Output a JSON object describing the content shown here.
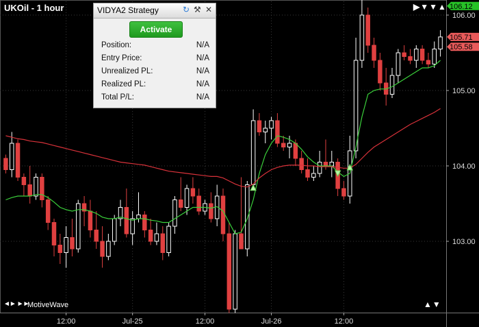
{
  "header": {
    "title": "UKOil - 1 hour"
  },
  "branding": {
    "name": "MotiveWave"
  },
  "strategy_panel": {
    "title": "VIDYA2 Strategy",
    "activate_label": "Activate",
    "rows": [
      {
        "label": "Position:",
        "value": "N/A"
      },
      {
        "label": "Entry Price:",
        "value": "N/A"
      },
      {
        "label": "Unrealized PL:",
        "value": "N/A"
      },
      {
        "label": "Realized PL:",
        "value": "N/A"
      },
      {
        "label": "Total P/L:",
        "value": "N/A"
      }
    ],
    "icons": [
      "refresh-icon",
      "wrench-icon",
      "close-icon"
    ]
  },
  "colors": {
    "bullish": "#000000",
    "bearish": "#e04040",
    "bull_border": "#ffffff",
    "fast_line": "#3bd13b",
    "slow_line": "#d9323a",
    "up_badge": "#27c227",
    "down_badge": "#e85a5a"
  },
  "chart_data": {
    "type": "candlestick",
    "title": "UKOil - 1 hour",
    "ylim": [
      102.05,
      106.2
    ],
    "y_ticks": [
      103.0,
      104.0,
      105.0,
      106.0
    ],
    "y_tick_labels": [
      "103.00",
      "104.00",
      "105.00",
      "106.00"
    ],
    "x_tick_labels": [
      {
        "index": 10,
        "label": "12:00"
      },
      {
        "index": 21,
        "label": "Jul-25"
      },
      {
        "index": 33,
        "label": "12:00"
      },
      {
        "index": 44,
        "label": "Jul-26"
      },
      {
        "index": 56,
        "label": "12:00"
      }
    ],
    "price_badges": [
      {
        "label": "106.12",
        "value": 106.12,
        "kind": "up"
      },
      {
        "label": "105.71",
        "value": 105.71,
        "kind": "down"
      },
      {
        "label": "105.58",
        "value": 105.58,
        "kind": "down"
      }
    ],
    "candles": [
      [
        104.1,
        104.15,
        103.9,
        103.95
      ],
      [
        103.95,
        104.45,
        103.85,
        104.3
      ],
      [
        104.3,
        104.35,
        103.8,
        103.85
      ],
      [
        103.85,
        103.9,
        103.6,
        103.75
      ],
      [
        103.75,
        104.0,
        103.5,
        103.6
      ],
      [
        103.6,
        103.9,
        103.55,
        103.85
      ],
      [
        103.85,
        103.9,
        103.45,
        103.55
      ],
      [
        103.55,
        103.6,
        103.15,
        103.25
      ],
      [
        103.25,
        103.3,
        102.8,
        102.95
      ],
      [
        102.95,
        103.1,
        102.7,
        102.85
      ],
      [
        102.85,
        103.2,
        102.65,
        103.05
      ],
      [
        103.05,
        103.3,
        102.8,
        102.9
      ],
      [
        102.9,
        103.55,
        102.85,
        103.5
      ],
      [
        103.5,
        103.6,
        103.2,
        103.4
      ],
      [
        103.4,
        103.55,
        103.05,
        103.15
      ],
      [
        103.15,
        103.4,
        102.9,
        103.0
      ],
      [
        103.0,
        103.2,
        102.65,
        102.8
      ],
      [
        102.8,
        103.1,
        102.75,
        103.0
      ],
      [
        103.0,
        103.35,
        102.95,
        103.3
      ],
      [
        103.3,
        103.55,
        103.2,
        103.45
      ],
      [
        103.45,
        103.7,
        103.05,
        103.1
      ],
      [
        103.1,
        103.4,
        102.95,
        103.3
      ],
      [
        103.3,
        103.65,
        103.25,
        103.35
      ],
      [
        103.35,
        103.4,
        103.05,
        103.15
      ],
      [
        103.15,
        103.3,
        102.95,
        103.0
      ],
      [
        103.0,
        103.25,
        102.95,
        103.1
      ],
      [
        103.1,
        103.2,
        102.75,
        102.85
      ],
      [
        102.85,
        103.25,
        102.8,
        103.2
      ],
      [
        103.2,
        103.6,
        103.1,
        103.55
      ],
      [
        103.55,
        103.85,
        103.4,
        103.45
      ],
      [
        103.45,
        103.75,
        103.35,
        103.7
      ],
      [
        103.7,
        103.85,
        103.5,
        103.6
      ],
      [
        103.6,
        103.7,
        103.35,
        103.4
      ],
      [
        103.4,
        103.55,
        103.35,
        103.5
      ],
      [
        103.5,
        103.65,
        103.25,
        103.3
      ],
      [
        103.3,
        103.75,
        103.2,
        103.6
      ],
      [
        103.6,
        103.7,
        103.0,
        103.1
      ],
      [
        103.1,
        103.25,
        102.05,
        102.1
      ],
      [
        102.1,
        103.15,
        102.05,
        103.1
      ],
      [
        103.1,
        103.85,
        102.95,
        102.9
      ],
      [
        102.9,
        103.8,
        102.8,
        103.75
      ],
      [
        103.75,
        104.75,
        103.7,
        104.6
      ],
      [
        104.6,
        104.7,
        104.4,
        104.45
      ],
      [
        104.45,
        104.6,
        104.3,
        104.5
      ],
      [
        104.5,
        104.65,
        104.35,
        104.6
      ],
      [
        104.6,
        104.7,
        104.25,
        104.3
      ],
      [
        104.3,
        104.4,
        104.2,
        104.25
      ],
      [
        104.25,
        104.4,
        104.1,
        104.3
      ],
      [
        104.3,
        104.35,
        104.0,
        104.1
      ],
      [
        104.1,
        104.2,
        103.9,
        103.95
      ],
      [
        103.95,
        104.1,
        103.8,
        103.85
      ],
      [
        103.85,
        104.0,
        103.8,
        103.9
      ],
      [
        103.9,
        104.2,
        103.85,
        104.05
      ],
      [
        104.05,
        104.35,
        103.95,
        104.0
      ],
      [
        104.0,
        104.2,
        103.85,
        104.05
      ],
      [
        104.05,
        104.1,
        103.6,
        103.7
      ],
      [
        103.7,
        103.8,
        103.55,
        103.6
      ],
      [
        103.6,
        104.4,
        103.5,
        104.2
      ],
      [
        104.2,
        105.7,
        104.1,
        105.4
      ],
      [
        105.4,
        106.2,
        105.3,
        106.0
      ],
      [
        106.0,
        106.1,
        105.5,
        105.6
      ],
      [
        105.6,
        105.7,
        105.3,
        105.4
      ],
      [
        105.4,
        105.5,
        105.0,
        105.1
      ],
      [
        105.1,
        105.3,
        104.8,
        104.95
      ],
      [
        104.95,
        105.3,
        104.9,
        105.2
      ],
      [
        105.2,
        105.55,
        105.1,
        105.5
      ],
      [
        105.5,
        105.6,
        105.4,
        105.45
      ],
      [
        105.45,
        105.55,
        105.35,
        105.4
      ],
      [
        105.4,
        105.6,
        105.3,
        105.55
      ],
      [
        105.55,
        105.6,
        105.35,
        105.4
      ],
      [
        105.4,
        105.5,
        105.3,
        105.35
      ],
      [
        105.35,
        105.65,
        105.3,
        105.55
      ],
      [
        105.55,
        105.8,
        105.45,
        105.71
      ]
    ],
    "series": [
      {
        "values": [
          103.55,
          103.58,
          103.6,
          103.6,
          103.6,
          103.62,
          103.62,
          103.58,
          103.52,
          103.45,
          103.42,
          103.4,
          103.42,
          103.42,
          103.4,
          103.37,
          103.32,
          103.3,
          103.3,
          103.32,
          103.3,
          103.28,
          103.3,
          103.3,
          103.28,
          103.27,
          103.25,
          103.25,
          103.3,
          103.35,
          103.4,
          103.45,
          103.45,
          103.45,
          103.44,
          103.46,
          103.4,
          103.25,
          103.1,
          103.12,
          103.3,
          103.55,
          103.9,
          104.15,
          104.3,
          104.4,
          104.38,
          104.35,
          104.3,
          104.22,
          104.12,
          104.05,
          104.0,
          104.0,
          104.0,
          103.92,
          103.86,
          103.9,
          104.25,
          104.65,
          104.95,
          105.0,
          105.02,
          105.02,
          105.05,
          105.1,
          105.15,
          105.2,
          105.25,
          105.3,
          105.3,
          105.33,
          105.4
        ]
      },
      {
        "values": [
          104.4,
          104.38,
          104.36,
          104.35,
          104.33,
          104.32,
          104.31,
          104.29,
          104.27,
          104.25,
          104.23,
          104.21,
          104.19,
          104.17,
          104.15,
          104.13,
          104.11,
          104.09,
          104.07,
          104.05,
          104.04,
          104.03,
          104.02,
          104.01,
          103.99,
          103.97,
          103.95,
          103.93,
          103.92,
          103.91,
          103.9,
          103.89,
          103.88,
          103.87,
          103.86,
          103.86,
          103.84,
          103.8,
          103.76,
          103.73,
          103.72,
          103.76,
          103.84,
          103.9,
          103.95,
          103.98,
          104.0,
          104.01,
          104.01,
          104.01,
          104.0,
          104.0,
          103.99,
          103.99,
          103.99,
          103.98,
          103.97,
          103.97,
          104.02,
          104.1,
          104.18,
          104.25,
          104.3,
          104.35,
          104.4,
          104.45,
          104.5,
          104.55,
          104.59,
          104.63,
          104.67,
          104.71,
          104.76
        ]
      }
    ],
    "signals": [
      {
        "index": 41,
        "value": 103.73,
        "kind": "up"
      },
      {
        "index": 55,
        "value": 103.9,
        "kind": "down"
      },
      {
        "index": 57,
        "value": 104.0,
        "kind": "up"
      }
    ]
  }
}
